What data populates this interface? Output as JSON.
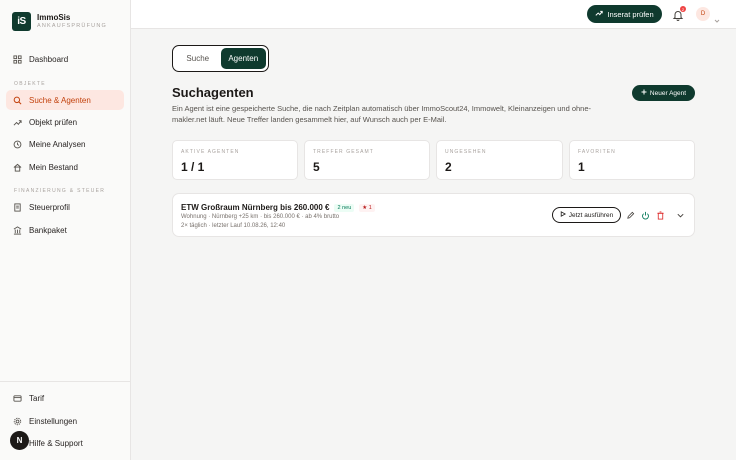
{
  "brand": {
    "logo": "iS",
    "name": "ImmoSis",
    "subtitle": "ANKAUFSPRÜFUNG"
  },
  "sidebar": {
    "dashboard": "Dashboard",
    "section_objekte": "OBJEKTE",
    "suche_agenten": "Suche & Agenten",
    "objekt_pruefen": "Objekt prüfen",
    "meine_analysen": "Meine Analysen",
    "mein_bestand": "Mein Bestand",
    "section_finanzierung": "FINANZIERUNG & STEUER",
    "steuerprofil": "Steuerprofil",
    "bankpaket": "Bankpaket",
    "tarif": "Tarif",
    "einstellungen": "Einstellungen",
    "hilfe": "Hilfe & Support",
    "floating_badge": "N"
  },
  "topbar": {
    "inserat_button": "Inserat prüfen",
    "notification_count": "2",
    "avatar_initial": "D"
  },
  "tabs": {
    "suche": "Suche",
    "agenten": "Agenten"
  },
  "page": {
    "title": "Suchagenten",
    "description": "Ein Agent ist eine gespeicherte Suche, die nach Zeitplan automatisch über ImmoScout24, Immowelt, Kleinanzeigen und ohne-makler.net läuft. Neue Treffer landen gesammelt hier, auf Wunsch auch per E-Mail.",
    "new_agent_button": "Neuer Agent"
  },
  "stats": [
    {
      "label": "AKTIVE AGENTEN",
      "value": "1 / 1"
    },
    {
      "label": "TREFFER GESAMT",
      "value": "5"
    },
    {
      "label": "UNGESEHEN",
      "value": "2"
    },
    {
      "label": "FAVORITEN",
      "value": "1"
    }
  ],
  "agent": {
    "title": "ETW Großraum Nürnberg bis 260.000 €",
    "badge_new": "2 neu",
    "badge_fav": "1",
    "meta": "Wohnung · Nürnberg +25 km · bis 260.000 € · ab 4% brutto",
    "schedule": "2× täglich · letzter Lauf 10.08.26, 12:40",
    "run_button": "Jetzt ausführen"
  },
  "colors": {
    "accent": "#0f3a2e",
    "active_nav_bg": "#fde7e1",
    "active_nav_text": "#c2410c",
    "danger": "#dc2626"
  }
}
